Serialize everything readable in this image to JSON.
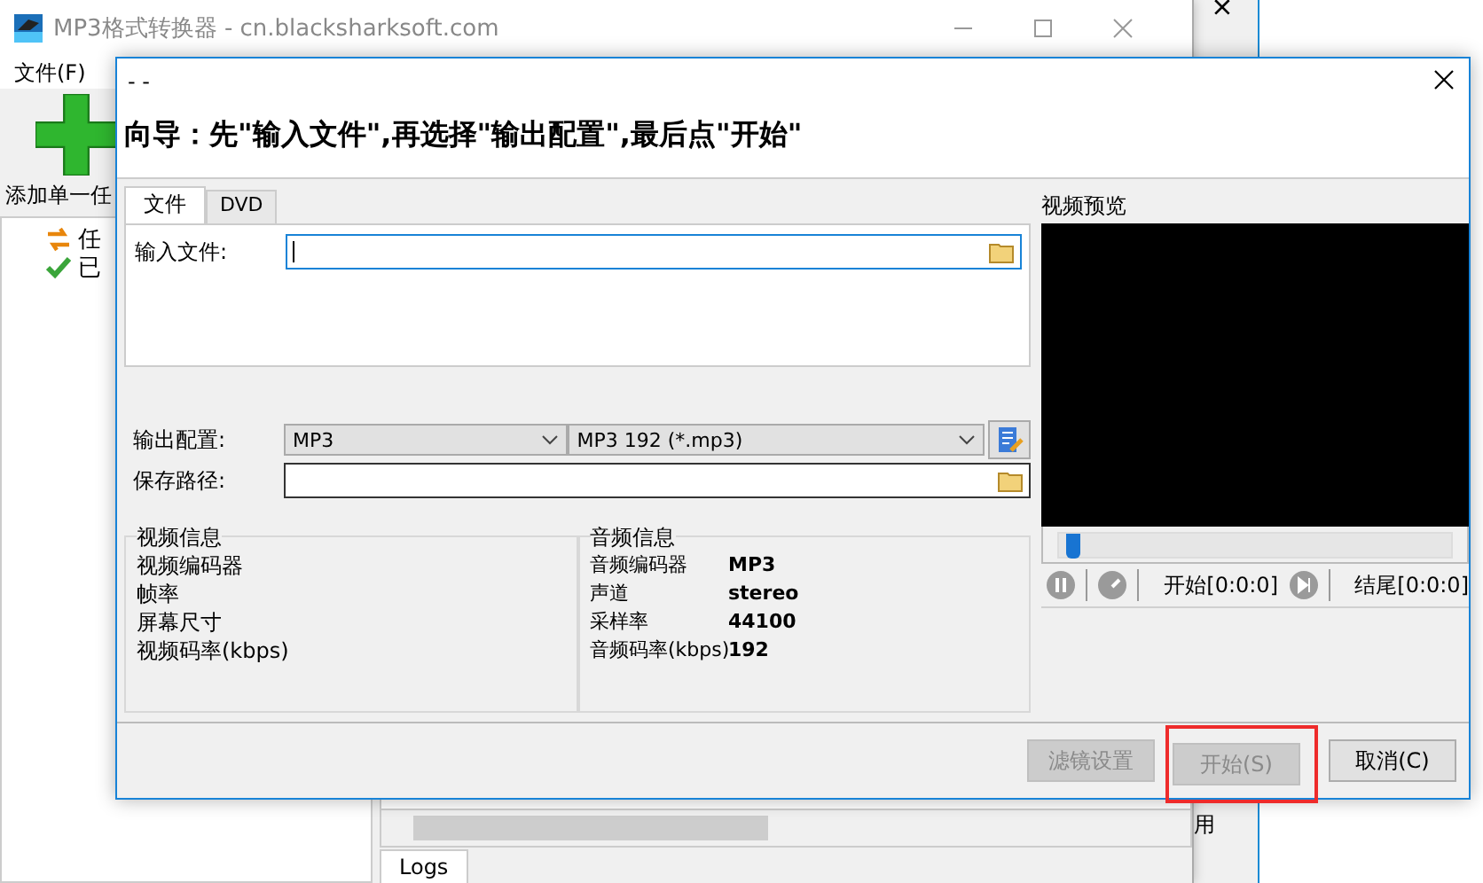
{
  "main_window": {
    "title": "MP3格式转换器 - cn.blacksharksoft.com",
    "menu": [
      "文件(F)"
    ],
    "toolbar": [
      {
        "label": "添加单一任"
      }
    ],
    "tree": [
      {
        "label": "任",
        "kind": "task"
      },
      {
        "label": "已",
        "kind": "done"
      }
    ],
    "bottom_tabs": [
      {
        "label": "Logs",
        "selected": true
      }
    ]
  },
  "back_window": {
    "text": "用"
  },
  "dialog": {
    "title": "- -",
    "heading": "向导：先\"输入文件\",再选择\"输出配置\",最后点\"开始\"",
    "tabs": [
      {
        "label": "文件",
        "selected": true
      },
      {
        "label": "DVD",
        "selected": false
      }
    ],
    "input_label": "输入文件:",
    "output_label": "输出配置:",
    "format": "MP3",
    "profile": "MP3 192 (*.mp3)",
    "path_label": "保存路径:",
    "video_info": {
      "title": "视频信息",
      "rows": [
        {
          "label": "视频编码器"
        },
        {
          "label": "帧率"
        },
        {
          "label": "屏幕尺寸"
        },
        {
          "label": "视频码率(kbps)"
        }
      ]
    },
    "audio_info": {
      "title": "音频信息",
      "rows": [
        {
          "label": "音频编码器",
          "value": "MP3"
        },
        {
          "label": "声道",
          "value": "stereo"
        },
        {
          "label": "采样率",
          "value": "44100"
        },
        {
          "label": "音频码率(kbps)",
          "value": "192"
        }
      ]
    },
    "preview": {
      "title": "视频预览",
      "level": 0.02,
      "start": "开始[0:0:0]",
      "end": "结尾[0:0:0]"
    },
    "buttons": [
      {
        "label": "滤镜设置",
        "disabled": true,
        "highlighted": false
      },
      {
        "label": "开始(S)",
        "disabled": true,
        "highlighted": true
      },
      {
        "label": "取消(C)",
        "disabled": false,
        "highlighted": false
      }
    ]
  }
}
